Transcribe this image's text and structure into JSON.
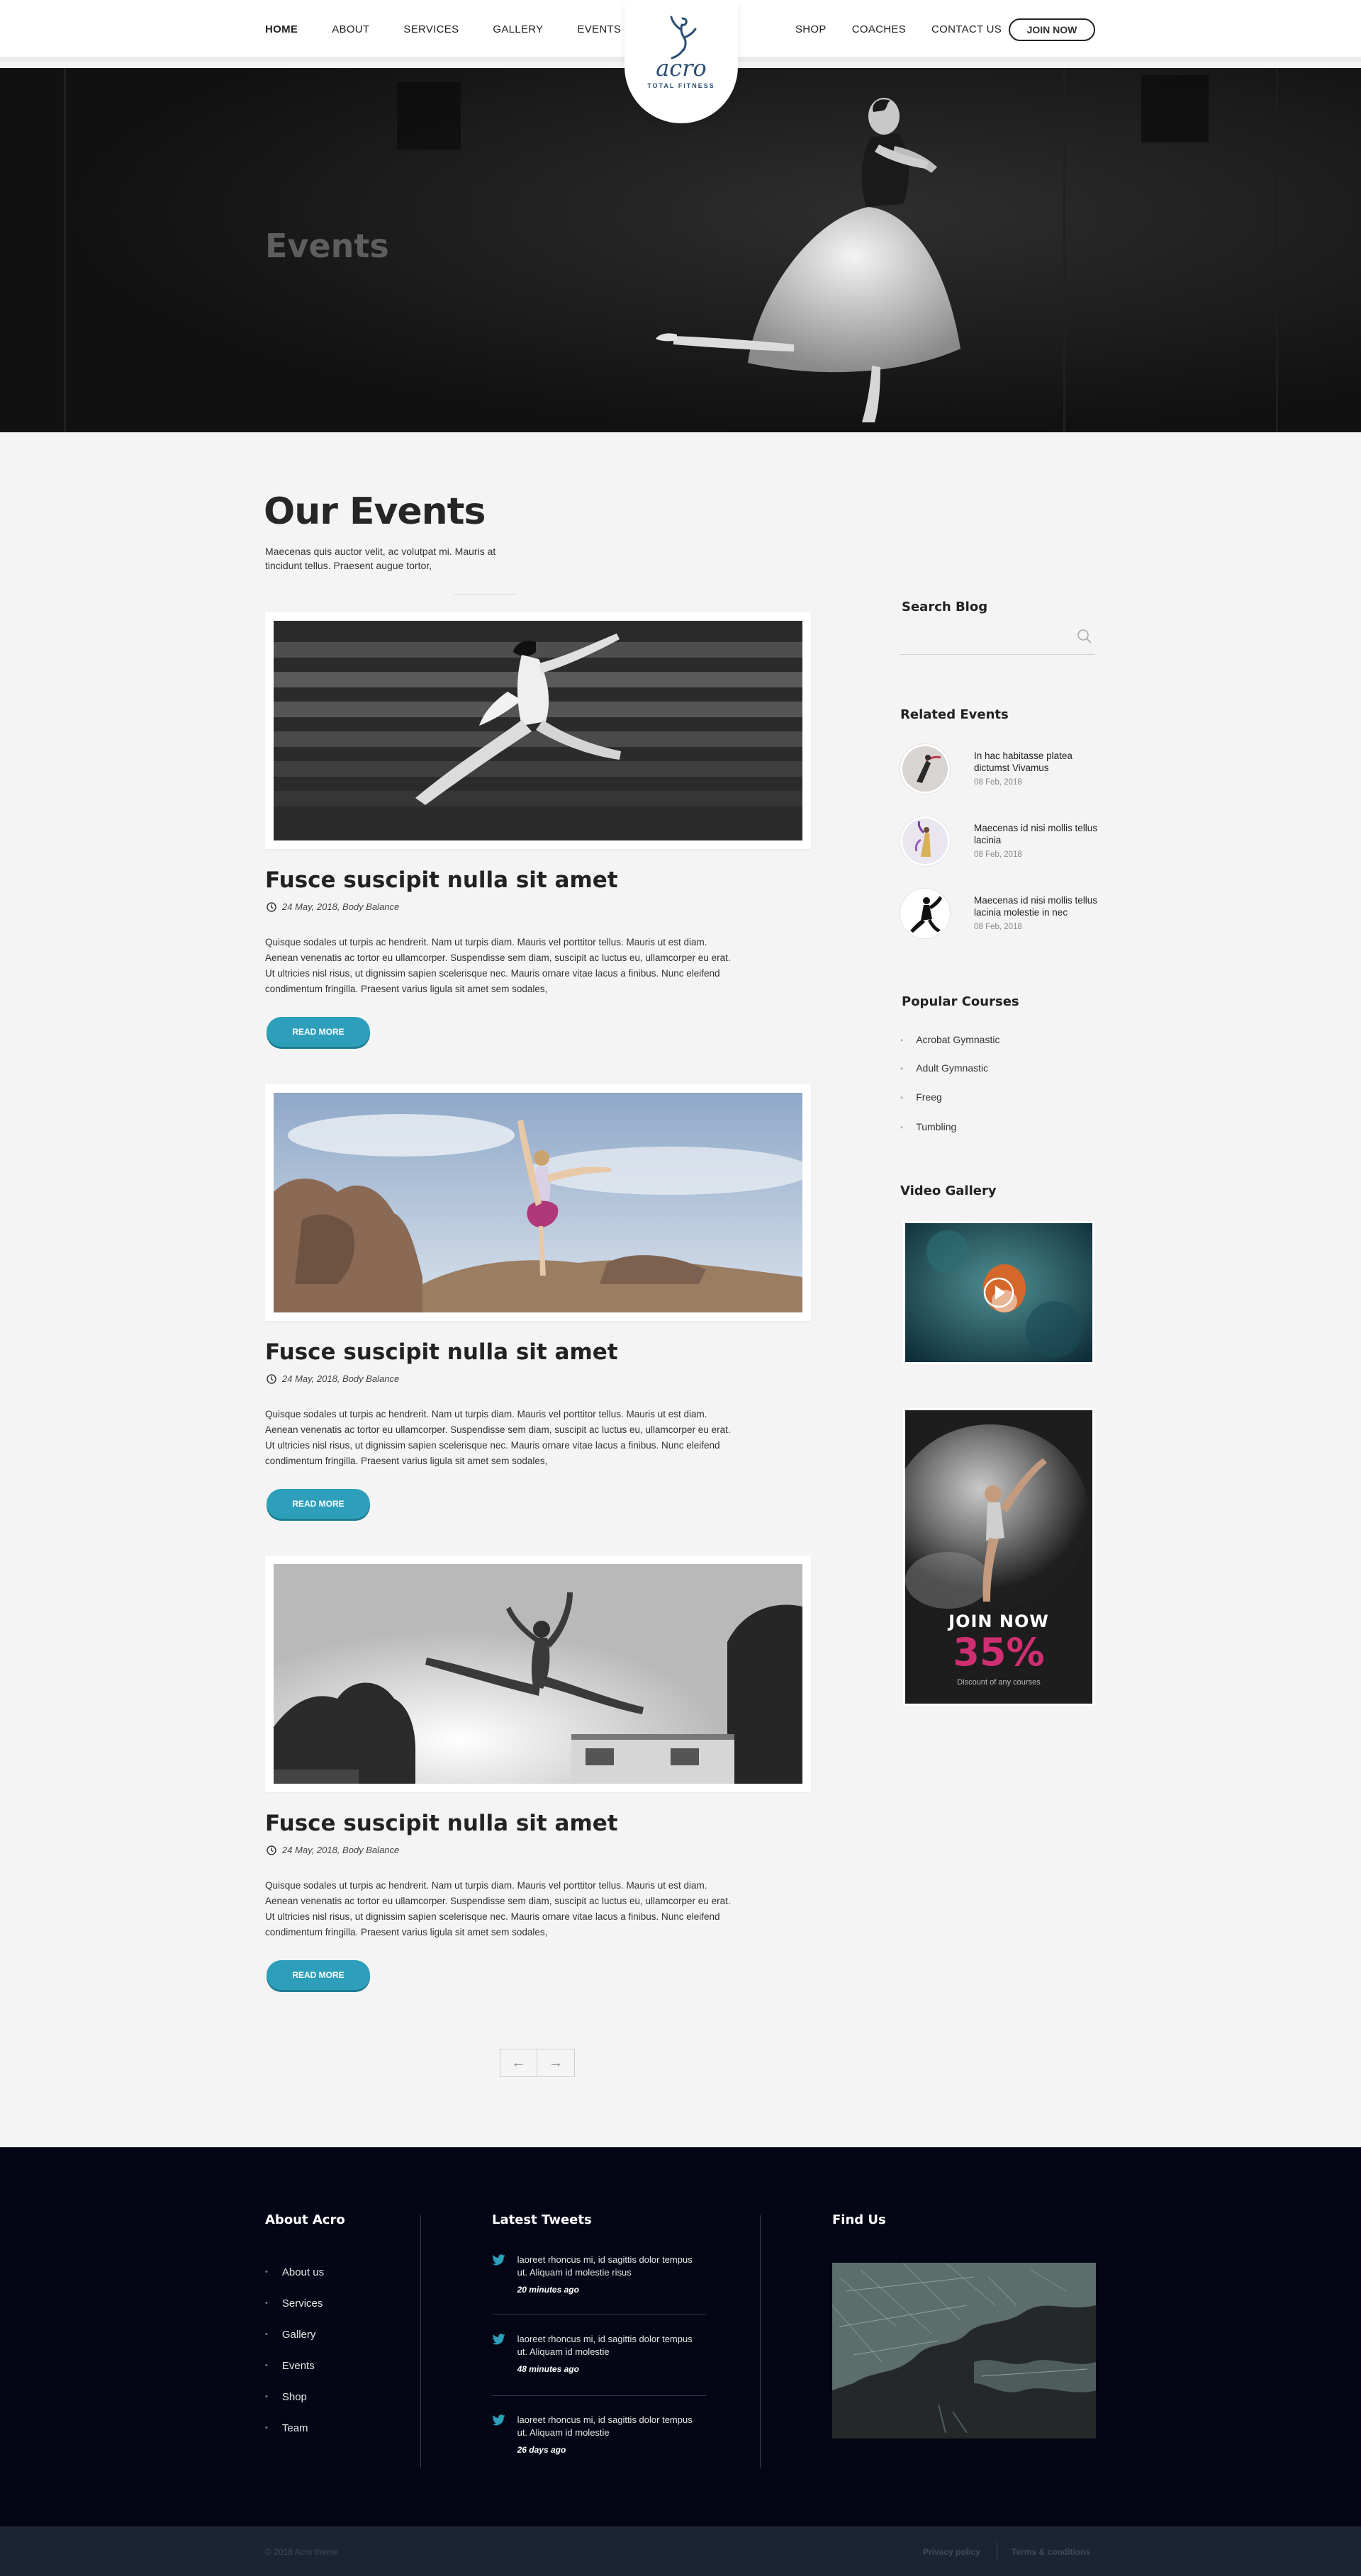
{
  "header": {
    "nav_left": [
      "HOME",
      "ABOUT",
      "SERVICES",
      "GALLERY",
      "EVENTS"
    ],
    "nav_right": [
      "SHOP",
      "COACHES",
      "CONTACT US"
    ],
    "join_label": "JOIN NOW",
    "logo_word": "acro",
    "logo_sub": "TOTAL FITNESS",
    "brand_color": "#2a4e73"
  },
  "hero": {
    "title": "Events"
  },
  "main": {
    "section_title": "Our Events",
    "section_intro": "Maecenas quis auctor velit, ac volutpat mi. Mauris at tincidunt tellus. Praesent augue tortor,",
    "events": [
      {
        "title": "Fusce suscipit nulla sit amet",
        "meta": "24 May, 2018, Body Balance",
        "body": "Quisque sodales ut turpis ac hendrerit. Nam ut turpis diam. Mauris vel porttitor tellus. Mauris ut est diam. Aenean venenatis ac tortor eu ullamcorper. Suspendisse sem diam, suscipit ac luctus eu, ullamcorper eu erat. Ut ultricies nisl risus, ut dignissim sapien scelerisque nec. Mauris ornare vitae lacus a finibus. Nunc eleifend condimentum fringilla. Praesent varius ligula sit amet sem sodales,",
        "button": "READ MORE"
      },
      {
        "title": "Fusce suscipit nulla sit amet",
        "meta": "24 May, 2018, Body Balance",
        "body": "Quisque sodales ut turpis ac hendrerit. Nam ut turpis diam. Mauris vel porttitor tellus. Mauris ut est diam. Aenean venenatis ac tortor eu ullamcorper. Suspendisse sem diam, suscipit ac luctus eu, ullamcorper eu erat. Ut ultricies nisl risus, ut dignissim sapien scelerisque nec. Mauris ornare vitae lacus a finibus. Nunc eleifend condimentum fringilla. Praesent varius ligula sit amet sem sodales,",
        "button": "READ MORE"
      },
      {
        "title": "Fusce suscipit nulla sit amet",
        "meta": "24 May, 2018, Body Balance",
        "body": "Quisque sodales ut turpis ac hendrerit. Nam ut turpis diam. Mauris vel porttitor tellus. Mauris ut est diam. Aenean venenatis ac tortor eu ullamcorper. Suspendisse sem diam, suscipit ac luctus eu, ullamcorper eu erat. Ut ultricies nisl risus, ut dignissim sapien scelerisque nec. Mauris ornare vitae lacus a finibus. Nunc eleifend condimentum fringilla. Praesent varius ligula sit amet sem sodales,",
        "button": "READ MORE"
      }
    ],
    "pager": [
      "←",
      "→"
    ]
  },
  "sidebar": {
    "search_title": "Search Blog",
    "related_title": "Related Events",
    "related": [
      {
        "title": "In hac habitasse platea dictumst Vivamus",
        "date": "08 Feb, 2018"
      },
      {
        "title": "Maecenas id nisi mollis tellus lacinia",
        "date": "08 Feb, 2018"
      },
      {
        "title": "Maecenas id nisi mollis tellus lacinia molestie in nec",
        "date": "08 Feb, 2018"
      }
    ],
    "courses_title": "Popular Courses",
    "courses": [
      "Acrobat Gymnastic",
      "Adult Gymnastic",
      "Freeg",
      "Tumbling"
    ],
    "video_title": "Video Gallery",
    "promo": {
      "title": "JOIN NOW",
      "percent": "35%",
      "subtitle": "Discount of any courses",
      "accent": "#cf2f72"
    }
  },
  "footer": {
    "about_title": "About Acro",
    "about_links": [
      "About us",
      "Services",
      "Gallery",
      "Events",
      "Shop",
      "Team"
    ],
    "tweets_title": "Latest Tweets",
    "tweets": [
      {
        "text": "laoreet rhoncus mi, id sagittis dolor tempus ut. Aliquam id molestie risus",
        "time": "20 minutes ago"
      },
      {
        "text": "laoreet rhoncus mi, id sagittis dolor tempus ut. Aliquam id molestie",
        "time": "48 minutes ago"
      },
      {
        "text": "laoreet rhoncus mi, id sagittis dolor tempus ut. Aliquam id molestie",
        "time": "26 days ago"
      }
    ],
    "find_title": "Find Us",
    "copyright": "© 2018 Acro theme",
    "privacy": "Privacy policy",
    "terms": "Terms & conditions",
    "accent": "#2d9fbb"
  }
}
